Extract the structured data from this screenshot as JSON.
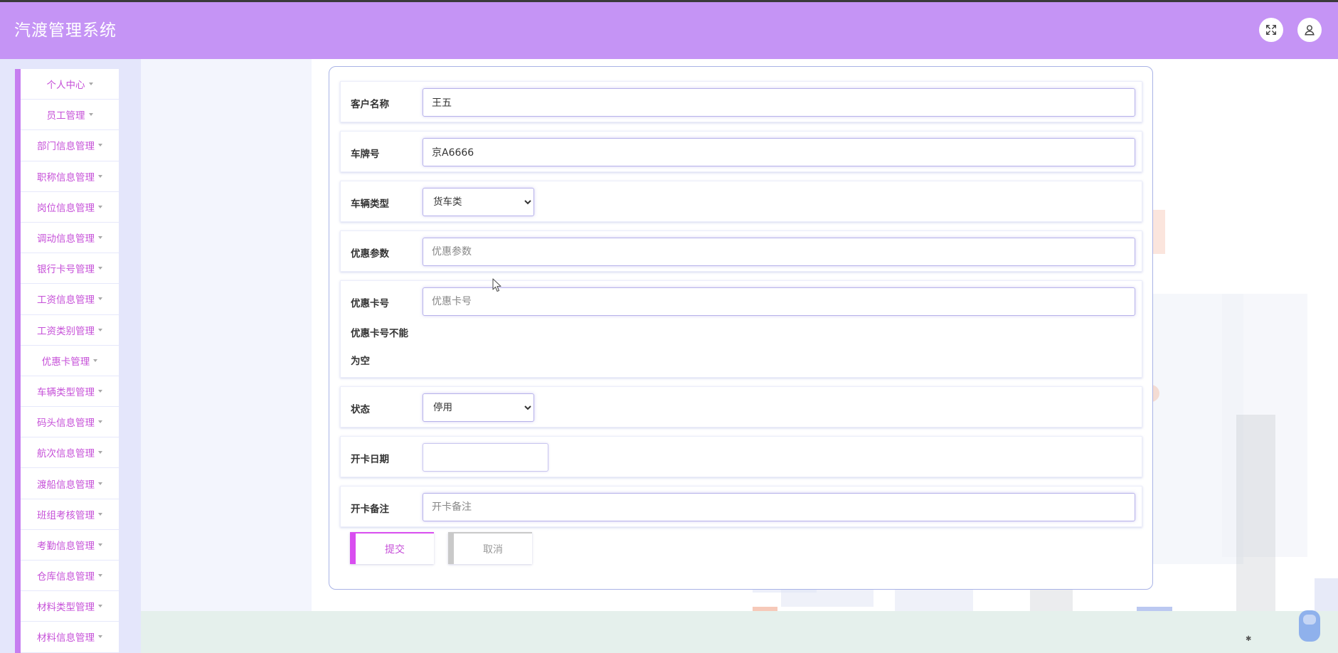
{
  "app": {
    "title": "汽渡管理系统"
  },
  "header": {
    "fullscreen_icon": "fullscreen-icon",
    "user_icon": "user-icon"
  },
  "colors": {
    "header": "#c594f5",
    "accent": "#c67ef0",
    "menu_text": "#c650d8"
  },
  "sidebar": {
    "items": [
      {
        "label": "个人中心"
      },
      {
        "label": "员工管理"
      },
      {
        "label": "部门信息管理"
      },
      {
        "label": "职称信息管理"
      },
      {
        "label": "岗位信息管理"
      },
      {
        "label": "调动信息管理"
      },
      {
        "label": "银行卡号管理"
      },
      {
        "label": "工资信息管理"
      },
      {
        "label": "工资类别管理"
      },
      {
        "label": "优惠卡管理"
      },
      {
        "label": "车辆类型管理"
      },
      {
        "label": "码头信息管理"
      },
      {
        "label": "航次信息管理"
      },
      {
        "label": "渡船信息管理"
      },
      {
        "label": "班组考核管理"
      },
      {
        "label": "考勤信息管理"
      },
      {
        "label": "仓库信息管理"
      },
      {
        "label": "材料类型管理"
      },
      {
        "label": "材料信息管理"
      }
    ]
  },
  "form": {
    "customer_name": {
      "label": "客户名称",
      "value": "王五"
    },
    "plate_number": {
      "label": "车牌号",
      "value": "京A6666"
    },
    "vehicle_type": {
      "label": "车辆类型",
      "selected": "货车类"
    },
    "discount_param": {
      "label": "优惠参数",
      "placeholder": "优惠参数"
    },
    "discount_card": {
      "label": "优惠卡号",
      "placeholder": "优惠卡号",
      "error": "优惠卡号不能为空"
    },
    "status": {
      "label": "状态",
      "selected": "停用"
    },
    "open_date": {
      "label": "开卡日期",
      "value": ""
    },
    "open_remark": {
      "label": "开卡备注",
      "placeholder": "开卡备注"
    },
    "submit_label": "提交",
    "cancel_label": "取消"
  }
}
